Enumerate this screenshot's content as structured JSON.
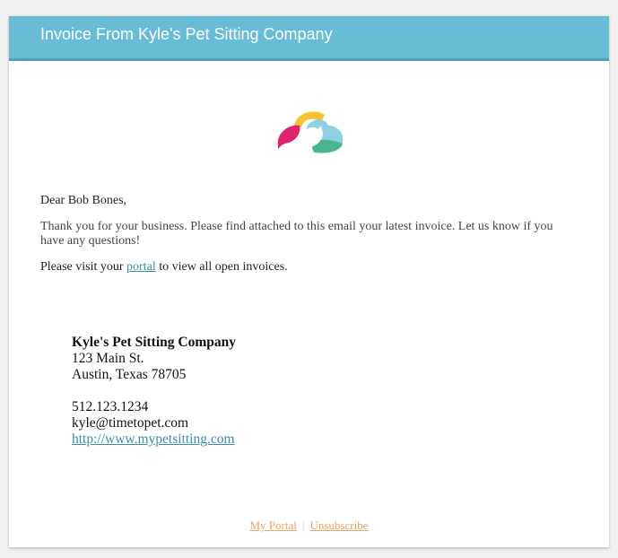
{
  "header": {
    "title": "Invoice From Kyle's Pet Sitting Company"
  },
  "logo": {
    "icon": "pet-sitting-logo-icon",
    "colors": [
      "#e0226c",
      "#f3c433",
      "#8cd1e0",
      "#49b58e"
    ]
  },
  "message": {
    "greeting": "Dear Bob Bones,",
    "thanks": "Thank you for your business. Please find attached to this email your latest invoice. Let us know if you have any questions!",
    "visit_prefix": "Please visit your ",
    "portal_link": "portal",
    "visit_suffix": " to view all open invoices."
  },
  "signature": {
    "company": "Kyle's Pet Sitting Company",
    "street": "123 Main St.",
    "city": "Austin, Texas 78705",
    "phone": "512.123.1234",
    "email": "kyle@timetopet.com",
    "website": "http://www.mypetsitting.com"
  },
  "footer": {
    "portal_label": "My Portal",
    "separator": "|",
    "unsubscribe_label": "Unsubscribe"
  },
  "colors": {
    "header_bg": "#68bcd6",
    "link": "#3b8ea5",
    "footer_link": "#e8a26a"
  }
}
